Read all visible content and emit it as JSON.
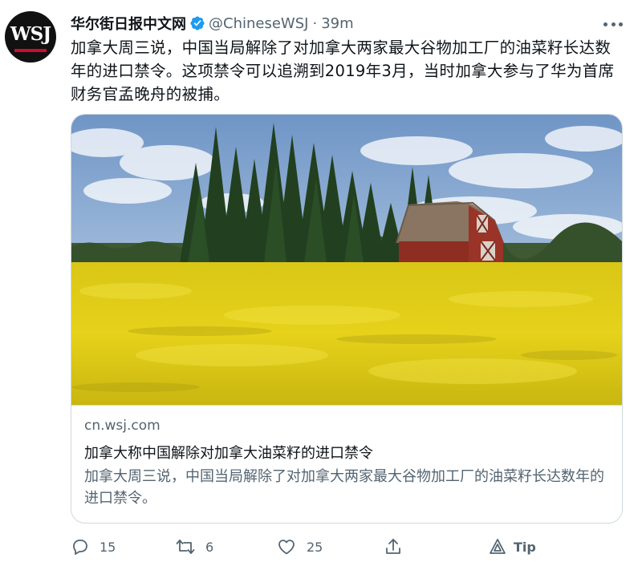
{
  "avatar": {
    "logo_text": "WSJ"
  },
  "author": {
    "name": "华尔街日报中文网",
    "handle": "@ChineseWSJ",
    "separator": "·",
    "time": "39m"
  },
  "tweet": {
    "text": "加拿大周三说，中国当局解除了对加拿大两家最大谷物加工厂的油菜籽长达数年的进口禁令。这项禁令可以追溯到2019年3月，当时加拿大参与了华为首席财务官孟晚舟的被捕。"
  },
  "card": {
    "domain": "cn.wsj.com",
    "title": "加拿大称中国解除对加拿大油菜籽的进口禁令",
    "description": "加拿大周三说，中国当局解除了对加拿大两家最大谷物加工厂的油菜籽长达数年的进口禁令。"
  },
  "actions": {
    "reply": {
      "icon": "reply-icon",
      "count": "15"
    },
    "retweet": {
      "icon": "retweet-icon",
      "count": "6"
    },
    "like": {
      "icon": "heart-icon",
      "count": "25"
    },
    "share": {
      "icon": "share-icon"
    },
    "tip": {
      "icon": "tip-icon",
      "label": "Tip"
    }
  },
  "colors": {
    "verified": "#1d9bf0",
    "secondary_text": "#536471",
    "primary_text": "#0f1419",
    "border": "#cfd9de"
  }
}
